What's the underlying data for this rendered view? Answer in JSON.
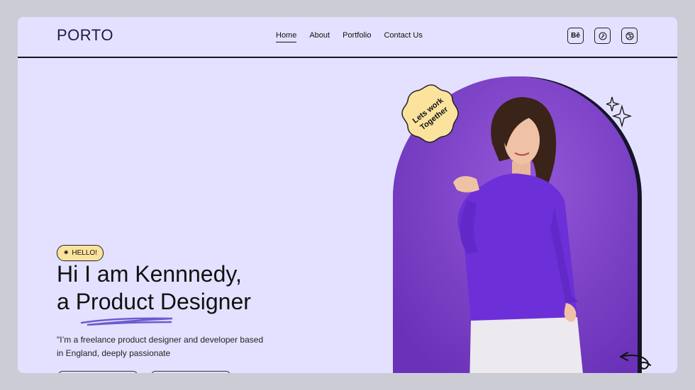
{
  "nav": {
    "logo": "PORTO",
    "links": [
      {
        "label": "Home",
        "active": true
      },
      {
        "label": "About"
      },
      {
        "label": "Portfolio"
      },
      {
        "label": "Contact Us"
      }
    ],
    "social": [
      {
        "icon": "behance-icon",
        "glyph": "Bē"
      },
      {
        "icon": "pinterest-icon"
      },
      {
        "icon": "dribbble-icon"
      }
    ]
  },
  "hero": {
    "badge": "HELLO!",
    "line1": "Hi I am Kennnedy,",
    "line2_prefix": "a ",
    "line2_emphasis": "Product",
    "line2_suffix": " Designer",
    "description": "\"I’m a freelance product designer and developer based in England, deeply passionate",
    "sticker_line1": "Lets work",
    "sticker_line2": "Together"
  },
  "colors": {
    "page_bg": "#e3e1ff",
    "arch_bg": "#7a3fca",
    "accent_yellow": "#fbe39e",
    "squiggle": "#6b5ccf"
  }
}
